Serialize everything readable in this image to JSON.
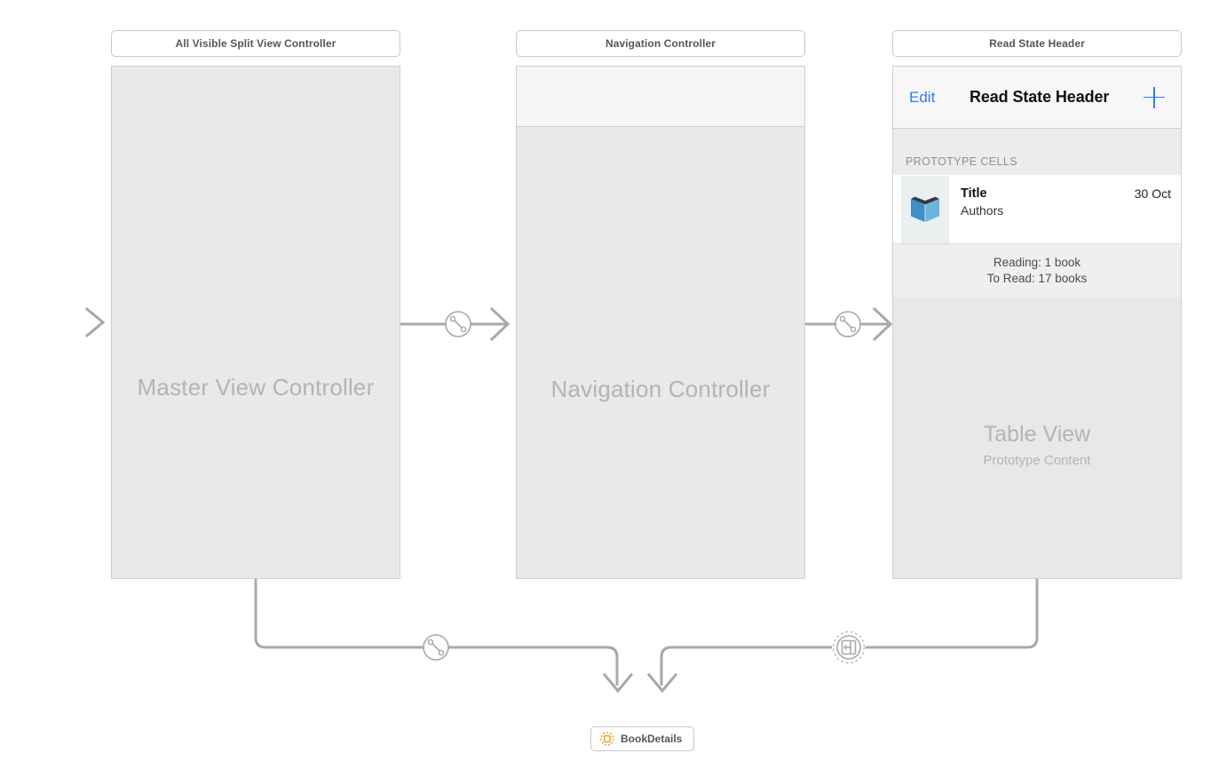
{
  "canvas": {
    "background": "#ffffff",
    "wire_color": "#a8a8a8"
  },
  "scenes": [
    {
      "id": "master",
      "title": "All Visible Split View Controller",
      "placeholder": "Master View Controller"
    },
    {
      "id": "navigation",
      "title": "Navigation Controller",
      "placeholder": "Navigation Controller"
    },
    {
      "id": "table",
      "title": "Read State Header",
      "navbar": {
        "edit_label": "Edit",
        "title": "Read State Header",
        "add_label": "+",
        "tint_color": "#2f7cf6"
      },
      "section_header": "PROTOTYPE CELLS",
      "prototype_cell": {
        "thumbnail_icon": "book-icon",
        "thumbnail_color": "#3d8ec9",
        "title": "Title",
        "subtitle": "Authors",
        "date": "30 Oct"
      },
      "section_footer": {
        "line1": "Reading: 1 book",
        "line2": "To Read: 17 books"
      },
      "tableview_label": {
        "main": "Table View",
        "sub": "Prototype Content"
      }
    }
  ],
  "storyboard_reference": {
    "label": "BookDetails",
    "icon": "storyboard-reference-icon",
    "icon_color": "#f0a92e"
  },
  "connections": [
    {
      "id": "entry-point",
      "icon": "entry-arrow-icon",
      "from": "canvas-edge",
      "to": "master"
    },
    {
      "id": "master-to-nav",
      "icon": "relationship-segue-icon",
      "from": "master",
      "to": "navigation"
    },
    {
      "id": "nav-to-table",
      "icon": "relationship-segue-icon",
      "from": "navigation",
      "to": "table"
    },
    {
      "id": "master-to-bookdetails",
      "icon": "relationship-segue-icon",
      "from": "master",
      "to": "storyboard-reference"
    },
    {
      "id": "table-to-bookdetails",
      "icon": "show-detail-segue-icon",
      "from": "table",
      "to": "storyboard-reference"
    }
  ]
}
